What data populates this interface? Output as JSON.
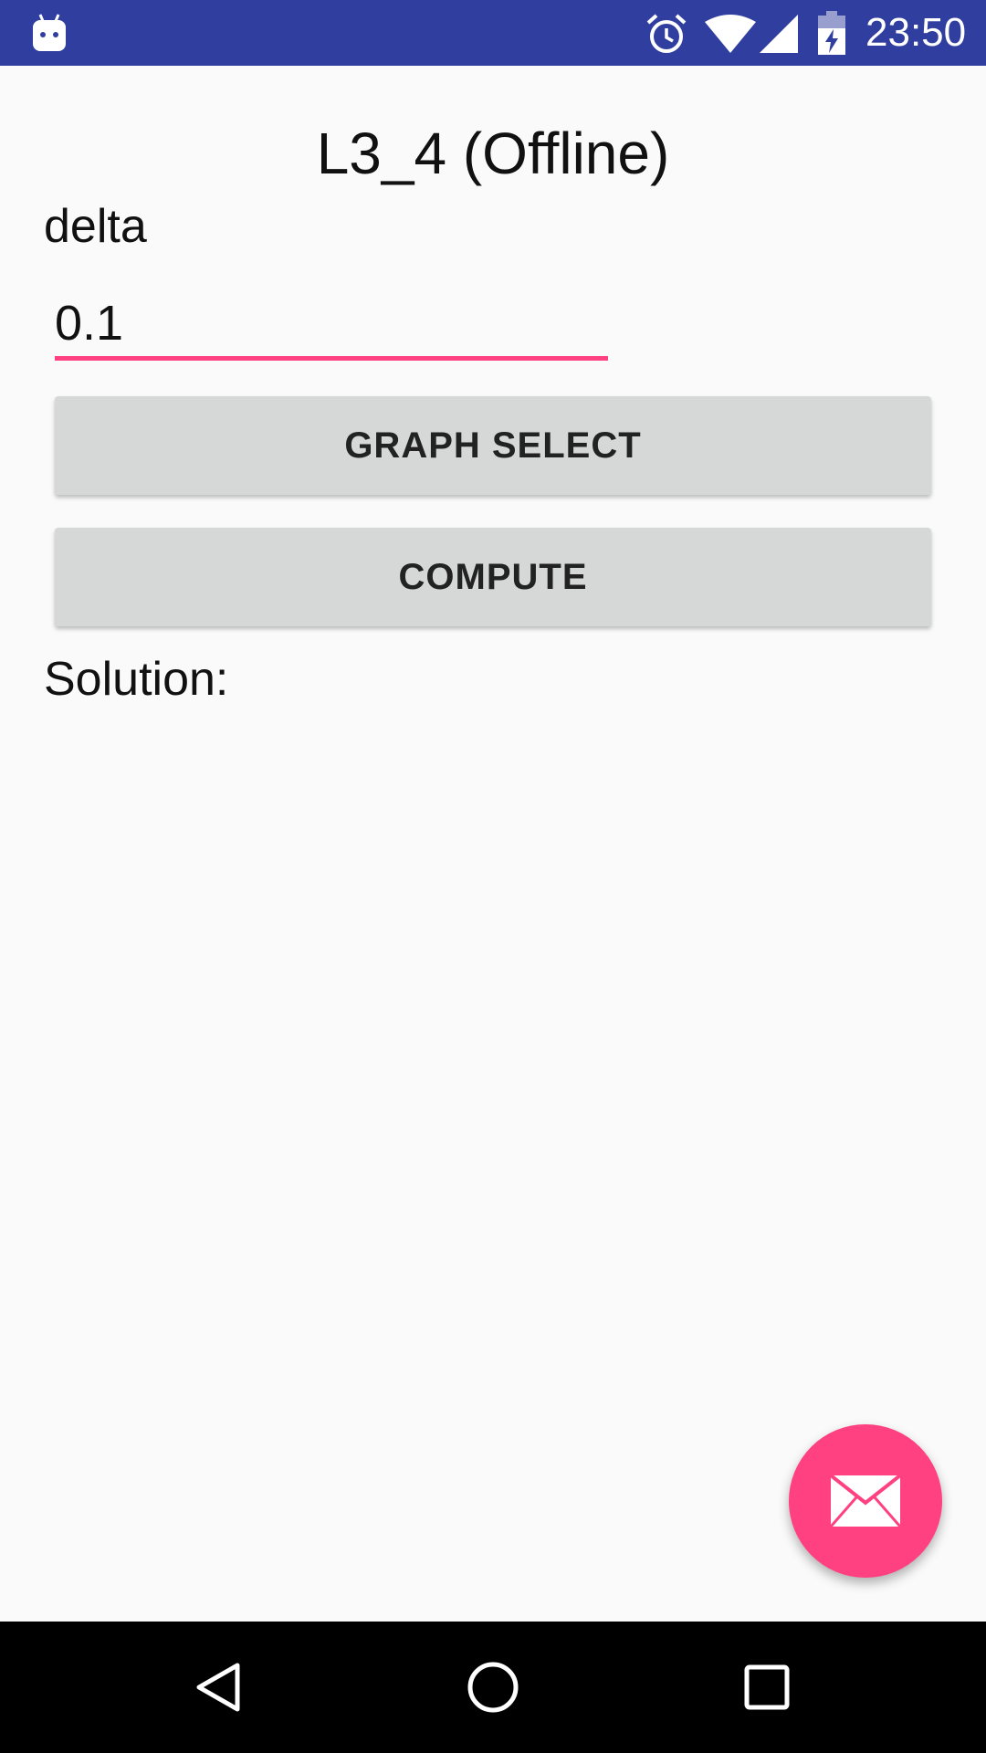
{
  "status_bar": {
    "time": "23:50",
    "icons": [
      "android-icon",
      "alarm-icon",
      "wifi-icon",
      "signal-icon",
      "battery-charging-icon"
    ]
  },
  "main": {
    "title": "L3_4 (Offline)",
    "delta_label": "delta",
    "delta_value": "0.1",
    "graph_select_label": "GRAPH SELECT",
    "compute_label": "COMPUTE",
    "solution_label": "Solution:"
  },
  "fab": {
    "icon": "mail-icon"
  },
  "nav_bar": {
    "icons": [
      "back-icon",
      "home-icon",
      "recents-icon"
    ]
  },
  "colors": {
    "status_bar": "#303f9f",
    "accent": "#ff4081",
    "button": "#d6d7d7",
    "background": "#fafafa"
  }
}
